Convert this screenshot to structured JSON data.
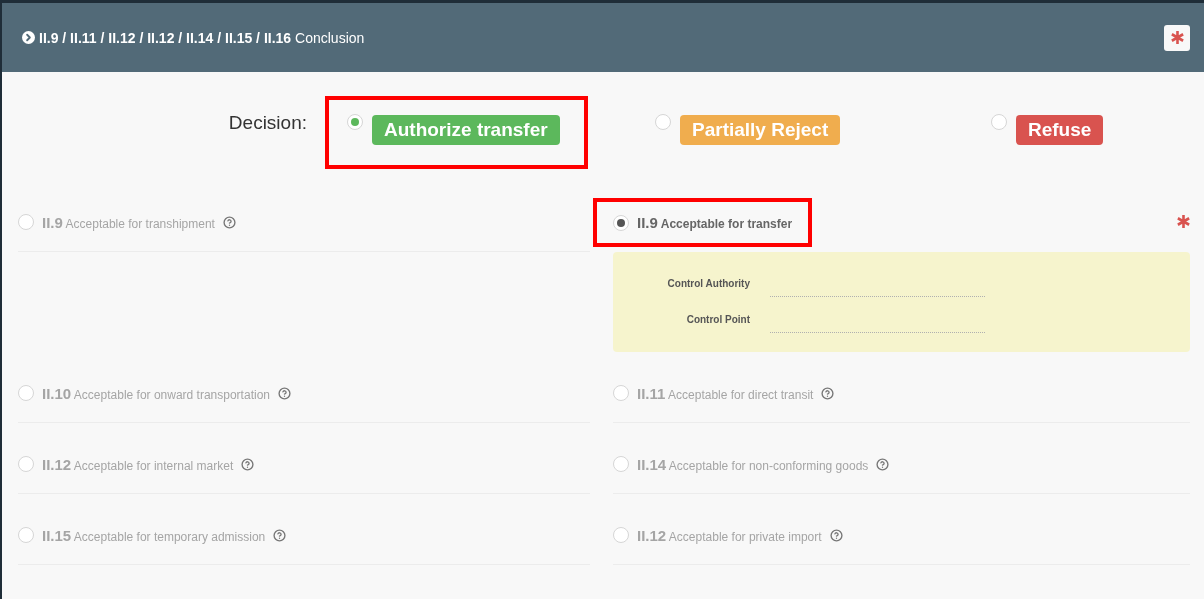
{
  "header": {
    "title": "**II.9 / II.11 / II.12 / II.12 / II.14 / II.15 / II.16** Conclusion",
    "required": true
  },
  "decision": {
    "label": "Decision:",
    "options": [
      {
        "label": "Authorize transfer",
        "color": "#5cb85c",
        "selected": true,
        "highlighted": true
      },
      {
        "label": "Partially Reject",
        "color": "#f0ad4e",
        "selected": false,
        "highlighted": false
      },
      {
        "label": "Refuse",
        "color": "#d9534f",
        "selected": false,
        "highlighted": false
      }
    ]
  },
  "purposes": [
    {
      "code": "II.9",
      "label": "Acceptable for transhipment",
      "selected": false,
      "highlighted": false,
      "help": true,
      "required": false
    },
    {
      "code": "II.9",
      "label": "Acceptable for transfer",
      "selected": true,
      "highlighted": true,
      "help": false,
      "required": true,
      "fields": [
        {
          "label": "Control Authority"
        },
        {
          "label": "Control Point"
        }
      ]
    },
    {
      "code": "II.10",
      "label": "Acceptable for onward transportation",
      "selected": false,
      "highlighted": false,
      "help": true,
      "required": false
    },
    {
      "code": "II.11",
      "label": "Acceptable for direct transit",
      "selected": false,
      "highlighted": false,
      "help": true,
      "required": false
    },
    {
      "code": "II.12",
      "label": "Acceptable for internal market",
      "selected": false,
      "highlighted": false,
      "help": true,
      "required": false
    },
    {
      "code": "II.14",
      "label": "Acceptable for non-conforming goods",
      "selected": false,
      "highlighted": false,
      "help": true,
      "required": false
    },
    {
      "code": "II.15",
      "label": "Acceptable for temporary admission",
      "selected": false,
      "highlighted": false,
      "help": true,
      "required": false
    },
    {
      "code": "II.12",
      "label": "Acceptable for private import",
      "selected": false,
      "highlighted": false,
      "help": true,
      "required": false
    }
  ]
}
